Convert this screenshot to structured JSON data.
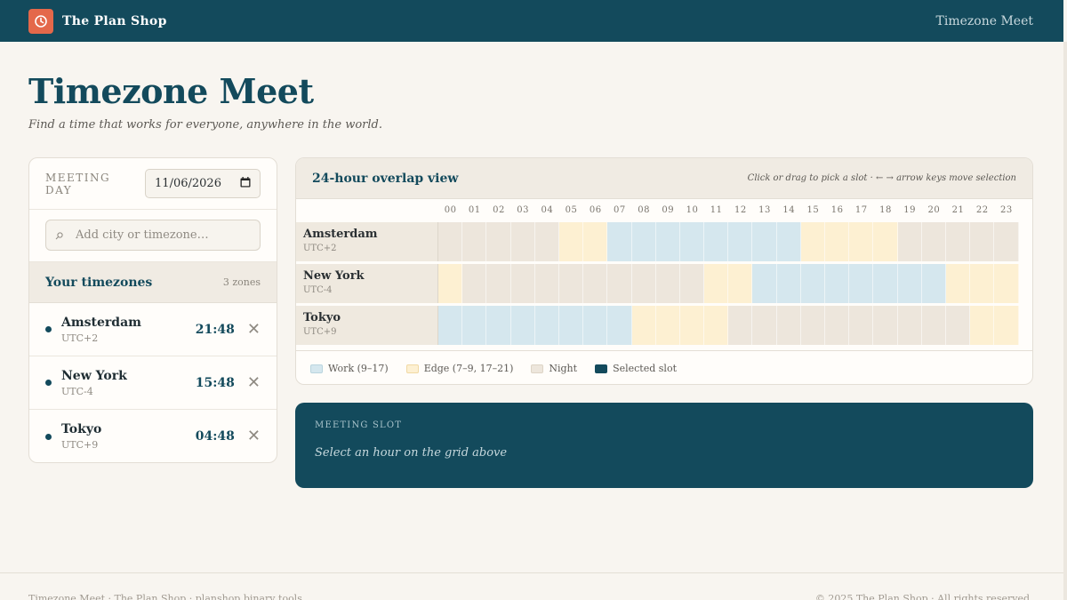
{
  "topbar": {
    "brand": "The Plan Shop",
    "nav_link": "Timezone Meet",
    "logo_icon": "clock-icon"
  },
  "page": {
    "title": "Timezone Meet",
    "subtitle": "Find a time that works for everyone, anywhere in the world."
  },
  "sidebar": {
    "day_label": "MEETING DAY",
    "date_value": "11/06/2026",
    "search_placeholder": "Add city or timezone…",
    "zones_title": "Your timezones",
    "zones_count": "3 zones",
    "zones": [
      {
        "name": "Amsterdam",
        "offset": "UTC+2",
        "time": "21:48"
      },
      {
        "name": "New York",
        "offset": "UTC-4",
        "time": "15:48"
      },
      {
        "name": "Tokyo",
        "offset": "UTC+9",
        "time": "04:48"
      }
    ]
  },
  "grid": {
    "title": "24-hour overlap view",
    "hint": "Click or drag to pick a slot · ← → arrow keys move selection",
    "hours": [
      "00",
      "01",
      "02",
      "03",
      "04",
      "05",
      "06",
      "07",
      "08",
      "09",
      "10",
      "11",
      "12",
      "13",
      "14",
      "15",
      "16",
      "17",
      "18",
      "19",
      "20",
      "21",
      "22",
      "23"
    ],
    "rows": [
      {
        "name": "Amsterdam",
        "offset": "UTC+2",
        "cells": [
          "night",
          "night",
          "night",
          "night",
          "night",
          "edge",
          "edge",
          "work",
          "work",
          "work",
          "work",
          "work",
          "work",
          "work",
          "work",
          "edge",
          "edge",
          "edge",
          "edge",
          "night",
          "night",
          "night",
          "night",
          "night"
        ]
      },
      {
        "name": "New York",
        "offset": "UTC-4",
        "cells": [
          "edge",
          "night",
          "night",
          "night",
          "night",
          "night",
          "night",
          "night",
          "night",
          "night",
          "night",
          "edge",
          "edge",
          "work",
          "work",
          "work",
          "work",
          "work",
          "work",
          "work",
          "work",
          "edge",
          "edge",
          "edge"
        ]
      },
      {
        "name": "Tokyo",
        "offset": "UTC+9",
        "cells": [
          "work",
          "work",
          "work",
          "work",
          "work",
          "work",
          "work",
          "work",
          "edge",
          "edge",
          "edge",
          "edge",
          "night",
          "night",
          "night",
          "night",
          "night",
          "night",
          "night",
          "night",
          "night",
          "night",
          "edge",
          "edge"
        ]
      }
    ],
    "legend": [
      {
        "label": "Work (9–17)",
        "color": "#d5e7ee",
        "border": "#b9d4de"
      },
      {
        "label": "Edge (7–9, 17–21)",
        "color": "#fdf0d2",
        "border": "#f1d9a4"
      },
      {
        "label": "Night",
        "color": "#ede6dc",
        "border": "#ddd4c6"
      },
      {
        "label": "Selected slot",
        "color": "#134a5c",
        "border": "#134a5c"
      }
    ]
  },
  "slot": {
    "label": "MEETING SLOT",
    "text": "Select an hour on the grid above"
  },
  "footer": {
    "left": "Timezone Meet · The Plan Shop · planshop binary tools",
    "right": "© 2025 The Plan Shop · All rights reserved"
  }
}
